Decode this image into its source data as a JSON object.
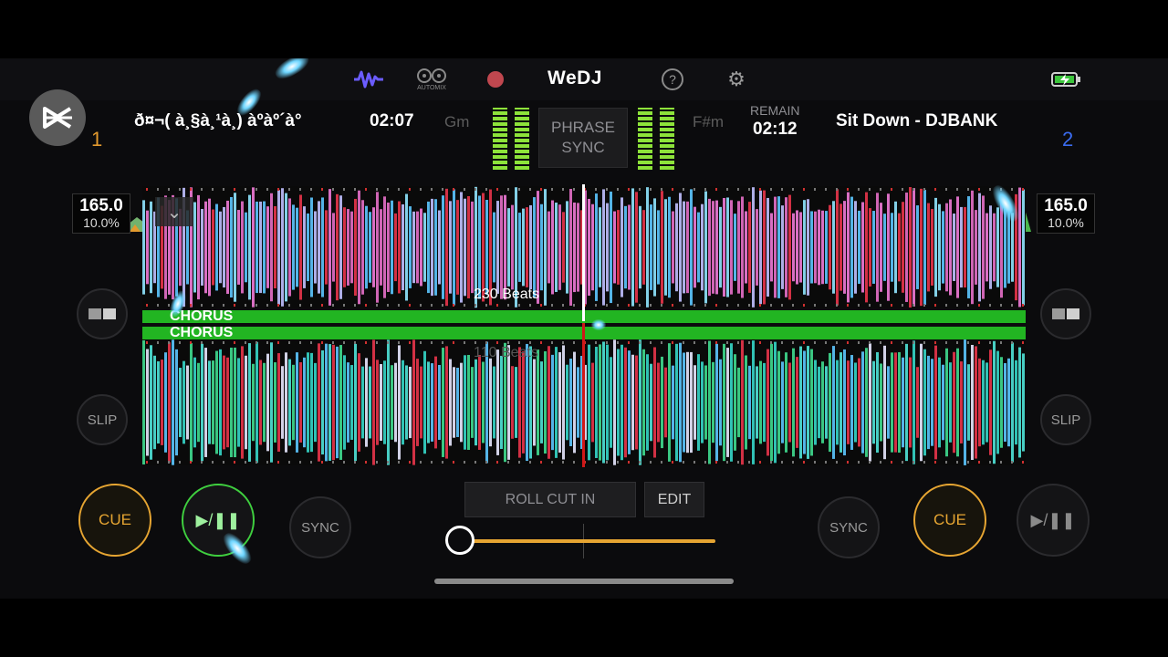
{
  "app": {
    "brand": "WeDJ",
    "automix_label": "AUTOMIX",
    "colors": {
      "cue": "#e6a532",
      "play": "#3fcf3f",
      "chorus": "#22b522",
      "deck1": "#e39a2e",
      "deck2": "#3b6cf0"
    }
  },
  "deck1": {
    "number": "1",
    "title": "ð¤¬( à¸§à¸¹à¸) àºàº´à°",
    "time": "02:07",
    "key": "Gm",
    "bpm": "165.0",
    "pitch": "10.0%",
    "slip_label": "SLIP",
    "cue_label": "CUE",
    "play_label": "▶/❚❚",
    "sync_label": "SYNC",
    "beats_label": "230 Beats",
    "section_label": "CHORUS"
  },
  "deck2": {
    "number": "2",
    "title": "Sit Down - DJBANK",
    "remain_label": "REMAIN",
    "time": "02:12",
    "key": "F#m",
    "bpm": "165.0",
    "pitch": "10.0%",
    "slip_label": "SLIP",
    "cue_label": "CUE",
    "play_label": "▶/❚❚",
    "sync_label": "SYNC",
    "beats_label": "110 Beats",
    "section_label": "CHORUS"
  },
  "mixer": {
    "phrase_sync_line1": "PHRASE",
    "phrase_sync_line2": "SYNC",
    "fx_label": "ROLL CUT IN",
    "edit_label": "EDIT",
    "crossfader_value": 0.0
  },
  "icons": [
    "waveform-icon",
    "automix-icon",
    "record-icon",
    "help-icon",
    "gear-icon",
    "battery-charging-icon",
    "capcut-logo-icon",
    "chevron-down-icon",
    "split-view-icon"
  ]
}
